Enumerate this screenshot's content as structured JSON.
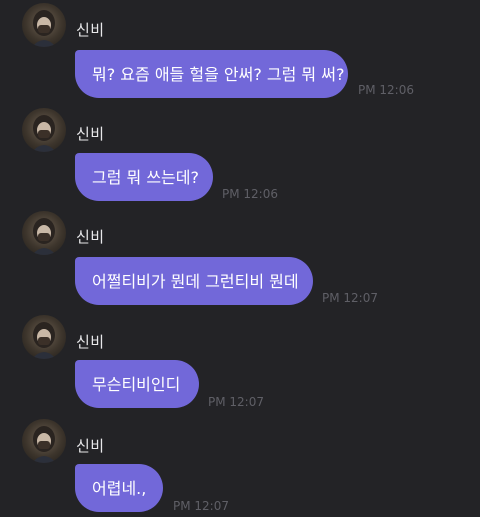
{
  "chat": {
    "messages": [
      {
        "sender": "신비",
        "text": "뭐? 요즘 애들 헐을 안써? 그럼 뭐 써?",
        "time": "PM 12:06"
      },
      {
        "sender": "신비",
        "text": "그럼 뭐 쓰는데?",
        "time": "PM 12:06"
      },
      {
        "sender": "신비",
        "text": "어쩔티비가 뭔데 그런티비 뭔데",
        "time": "PM 12:07"
      },
      {
        "sender": "신비",
        "text": "무슨티비인디",
        "time": "PM 12:07"
      },
      {
        "sender": "신비",
        "text": "어렵네.,",
        "time": "PM 12:07"
      }
    ]
  },
  "icons": {
    "avatar": "profile-photo"
  },
  "colors": {
    "background": "#232326",
    "bubble": "#7268d9",
    "timestamp": "#5f5f66",
    "name": "#e8e8ea"
  }
}
